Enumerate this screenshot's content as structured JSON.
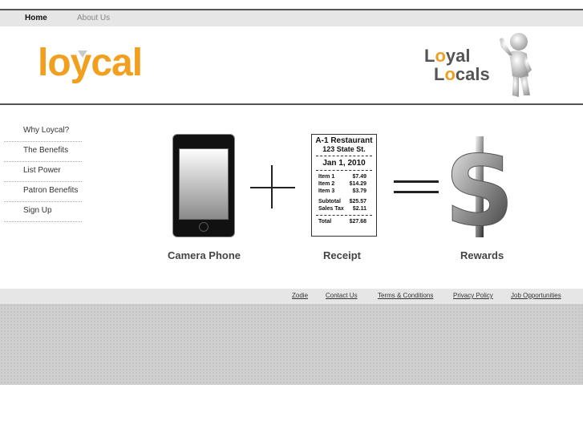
{
  "nav": {
    "home": "Home",
    "about": "About Us"
  },
  "brand": {
    "logo": "loycal",
    "tag_line1_pre": "L",
    "tag_line1_o": "o",
    "tag_line1_post": "yal",
    "tag_line2_pre": "L",
    "tag_line2_o": "o",
    "tag_line2_post": "cals"
  },
  "colors": {
    "accent": "#f0a01e",
    "nav_bg": "#e6e6e6",
    "rule": "#555555"
  },
  "sidebar": {
    "items": [
      {
        "label": "Why Loycal?"
      },
      {
        "label": "The Benefits"
      },
      {
        "label": "List Power"
      },
      {
        "label": "Patron Benefits"
      },
      {
        "label": "Sign Up"
      }
    ]
  },
  "equation": {
    "phone_caption": "Camera Phone",
    "receipt_caption": "Receipt",
    "rewards_caption": "Rewards"
  },
  "receipt": {
    "title": "A-1 Restaurant",
    "address": "123 State St.",
    "date": "Jan 1, 2010",
    "items": [
      {
        "name": "Item 1",
        "price": "$7.49"
      },
      {
        "name": "Item 2",
        "price": "$14.29"
      },
      {
        "name": "Item 3",
        "price": "$3.79"
      }
    ],
    "subtotal_label": "Subtotal",
    "subtotal": "$25.57",
    "tax_label": "Sales Tax",
    "tax": "$2.11",
    "total_label": "Total",
    "total": "$27.68"
  },
  "footer": {
    "links": [
      "Zodie",
      "Contact Us",
      "Terms & Conditions",
      "Privacy Policy",
      "Job Opportunities"
    ]
  },
  "icons": {
    "phone": "smartphone-icon",
    "plus": "plus-icon",
    "equals": "equals-icon",
    "dollar": "dollar-icon",
    "mascot": "thumbs-up-mascot-icon"
  }
}
